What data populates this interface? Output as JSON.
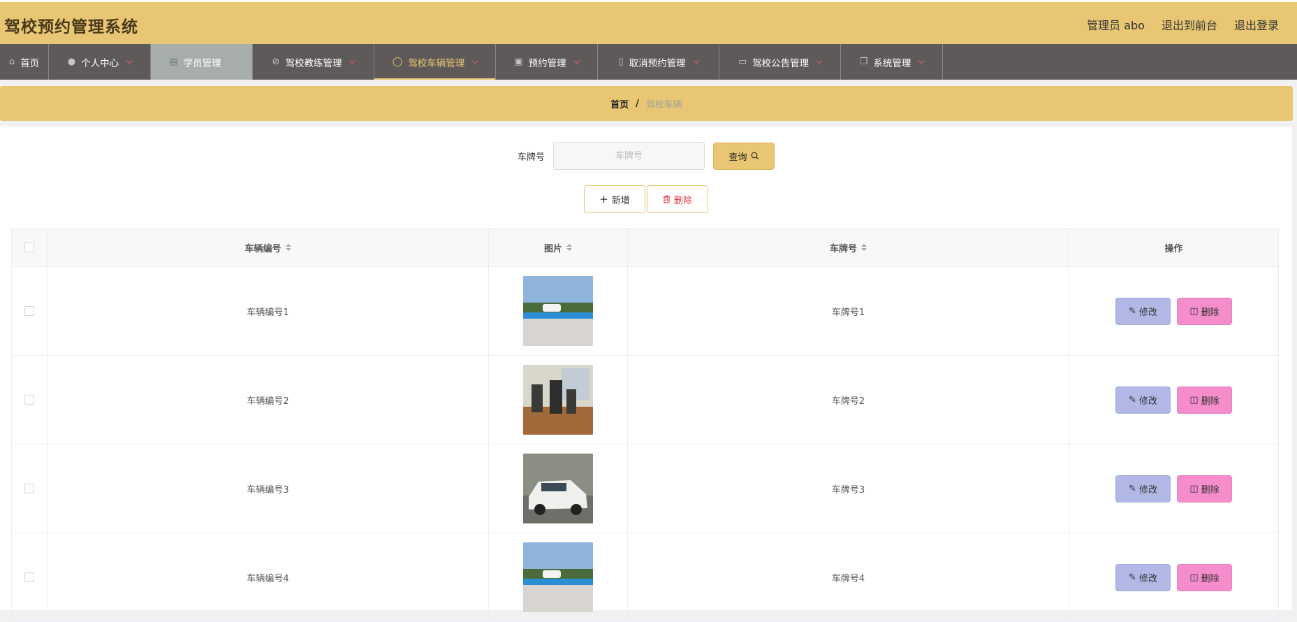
{
  "header": {
    "title": "驾校预约管理系统",
    "admin_label": "管理员 abo",
    "to_front": "退出到前台",
    "logout": "退出登录"
  },
  "nav": {
    "items": [
      {
        "label": "首页",
        "icon": "home-icon"
      },
      {
        "label": "个人中心",
        "icon": "user-icon"
      },
      {
        "label": "学员管理",
        "icon": "chart-icon"
      },
      {
        "label": "驾校教练管理",
        "icon": "slash-icon"
      },
      {
        "label": "驾校车辆管理",
        "icon": "compass-icon"
      },
      {
        "label": "预约管理",
        "icon": "briefcase-icon"
      },
      {
        "label": "取消预约管理",
        "icon": "clipboard-icon"
      },
      {
        "label": "驾校公告管理",
        "icon": "monitor-icon"
      },
      {
        "label": "系统管理",
        "icon": "copy-icon"
      }
    ]
  },
  "breadcrumb": {
    "home": "首页",
    "separator": "/",
    "current": "驾校车辆"
  },
  "search": {
    "label": "车牌号",
    "placeholder": "车牌号",
    "value": "",
    "button": "查询"
  },
  "actions": {
    "add": "新增",
    "delete": "删除"
  },
  "table": {
    "columns": [
      "车辆编号",
      "图片",
      "车牌号",
      "操作"
    ],
    "edit_label": "修改",
    "delete_label": "删除",
    "rows": [
      {
        "number": "车辆编号1",
        "image": "training-lot-photo",
        "plate": "车牌号1"
      },
      {
        "number": "车辆编号2",
        "image": "simulator-room-photo",
        "plate": "车牌号2"
      },
      {
        "number": "车辆编号3",
        "image": "white-car-photo",
        "plate": "车牌号3"
      },
      {
        "number": "车辆编号4",
        "image": "training-lot-photo",
        "plate": "车牌号4"
      }
    ]
  },
  "colors": {
    "accent": "#e8c673",
    "nav_bg": "#5f5a5a",
    "edit_btn": "#b1b8e6",
    "delete_btn": "#f58ccc"
  }
}
